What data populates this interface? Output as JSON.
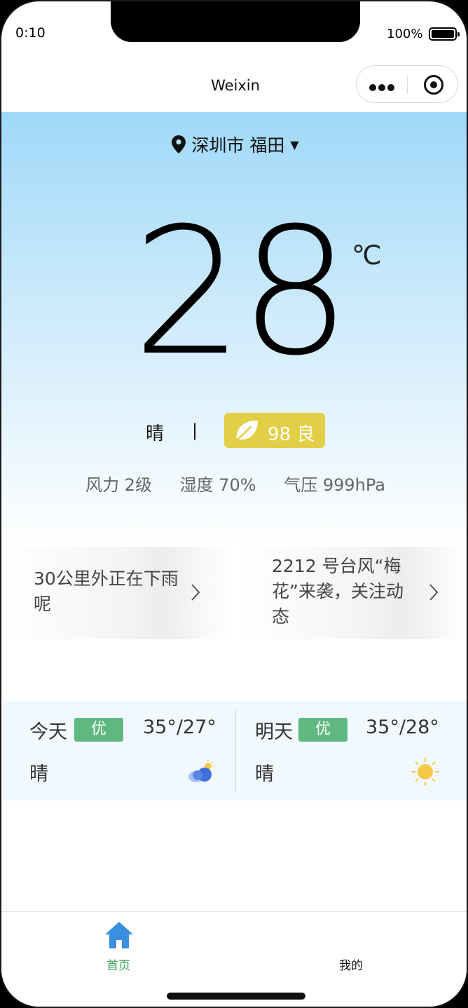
{
  "status_bar": {
    "time": "0:10",
    "battery": "100%"
  },
  "nav": {
    "title": "Weixin"
  },
  "location": {
    "city": "深圳市",
    "district": "福田"
  },
  "weather": {
    "temperature": "28",
    "unit": "℃",
    "condition": "晴",
    "separator": "|",
    "aqi_value": "98",
    "aqi_level": "良",
    "aqi_color": "#e2cf47",
    "metrics": [
      "风力 2级",
      "湿度 70%",
      "气压 999hPa"
    ]
  },
  "alerts": [
    {
      "text": "30公里外正在下雨呢"
    },
    {
      "text": "2212 号台风“梅花”来袭，关注动态"
    }
  ],
  "forecast": [
    {
      "day": "今天",
      "quality": "优",
      "temp_range": "35°/27°",
      "condition": "晴",
      "icon": "cloudy-sun-icon"
    },
    {
      "day": "明天",
      "quality": "优",
      "temp_range": "35°/28°",
      "condition": "晴",
      "icon": "sun-icon"
    }
  ],
  "tabbar": {
    "items": [
      {
        "label": "首页",
        "icon": "home-icon",
        "active": true,
        "color": "#3aa355"
      },
      {
        "label": "我的",
        "active": false
      }
    ]
  }
}
